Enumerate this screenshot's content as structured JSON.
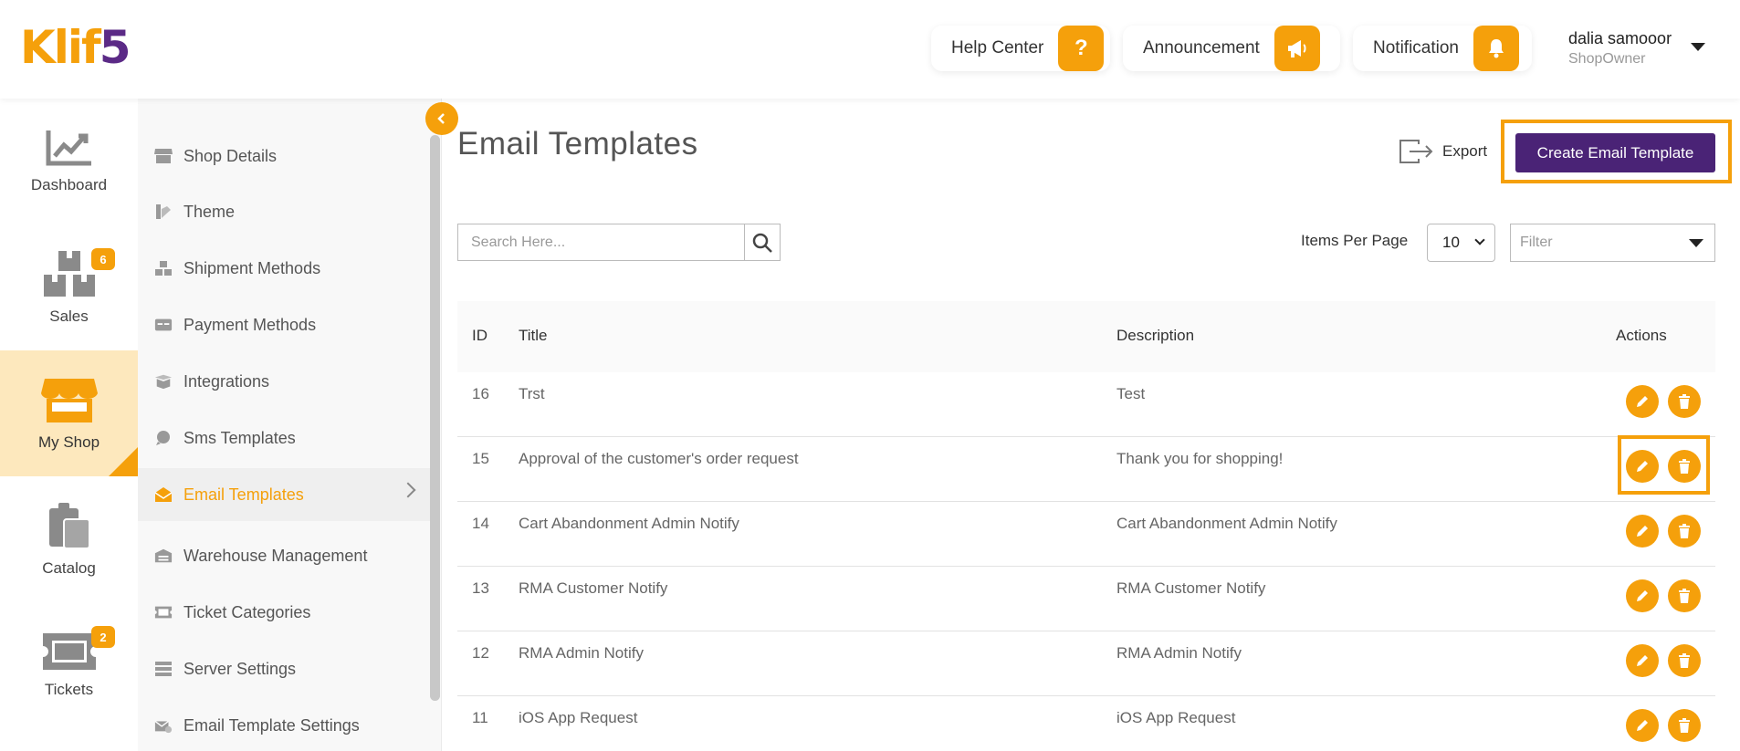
{
  "brand": {
    "logo_main": "Klif",
    "logo_accent": "5",
    "accent_color": "#f5a00b",
    "brand_purple": "#4a2376"
  },
  "topbar": {
    "help_label": "Help Center",
    "announcement_label": "Announcement",
    "notification_label": "Notification",
    "user_name": "dalia samooor",
    "user_role": "ShopOwner"
  },
  "rail": {
    "items": [
      {
        "label": "Dashboard",
        "icon": "chart-icon"
      },
      {
        "label": "Sales",
        "icon": "boxes-icon",
        "badge": "6"
      },
      {
        "label": "My Shop",
        "icon": "store-icon"
      },
      {
        "label": "Catalog",
        "icon": "clipboard-icon"
      },
      {
        "label": "Tickets",
        "icon": "ticket-icon",
        "badge": "2"
      }
    ]
  },
  "subnav": {
    "items": [
      {
        "label": "Shop Details"
      },
      {
        "label": "Theme"
      },
      {
        "label": "Shipment Methods"
      },
      {
        "label": "Payment Methods"
      },
      {
        "label": "Integrations"
      },
      {
        "label": "Sms Templates"
      },
      {
        "label": "Email Templates"
      },
      {
        "label": "Warehouse Management"
      },
      {
        "label": "Ticket Categories"
      },
      {
        "label": "Server Settings"
      },
      {
        "label": "Email Template Settings"
      }
    ]
  },
  "main": {
    "title": "Email Templates",
    "export_label": "Export",
    "create_label": "Create Email Template",
    "search_placeholder": "Search Here...",
    "items_per_page_label": "Items Per Page",
    "items_per_page_value": "10",
    "filter_placeholder": "Filter"
  },
  "table": {
    "headers": {
      "id": "ID",
      "title": "Title",
      "description": "Description",
      "actions": "Actions"
    },
    "rows": [
      {
        "id": "16",
        "title": "Trst",
        "description": "Test"
      },
      {
        "id": "15",
        "title": "Approval of the customer's order request",
        "description": "Thank you for shopping!"
      },
      {
        "id": "14",
        "title": "Cart Abandonment Admin Notify",
        "description": "Cart Abandonment Admin Notify"
      },
      {
        "id": "13",
        "title": "RMA Customer Notify",
        "description": "RMA Customer Notify"
      },
      {
        "id": "12",
        "title": "RMA Admin Notify",
        "description": "RMA Admin Notify"
      },
      {
        "id": "11",
        "title": "iOS App Request",
        "description": "iOS App Request"
      }
    ]
  }
}
